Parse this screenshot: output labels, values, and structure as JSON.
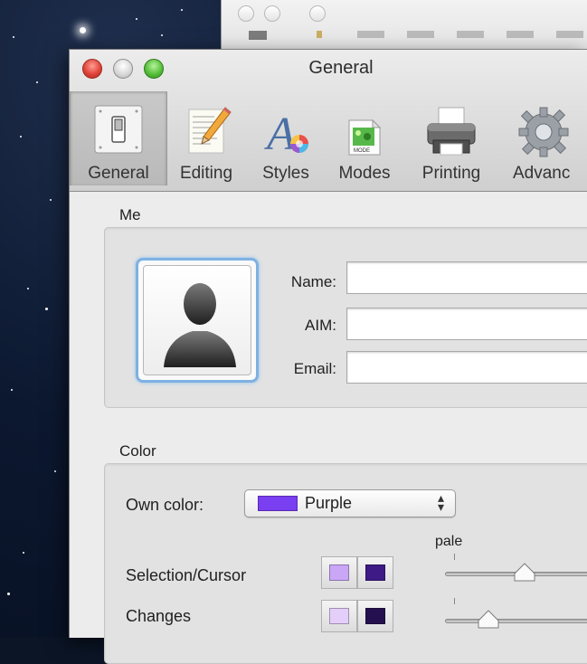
{
  "window": {
    "title": "General"
  },
  "toolbar": {
    "items": [
      {
        "label": "General",
        "icon": "switch-icon",
        "selected": true
      },
      {
        "label": "Editing",
        "icon": "notepad-pencil-icon",
        "selected": false
      },
      {
        "label": "Styles",
        "icon": "styles-letter-icon",
        "selected": false
      },
      {
        "label": "Modes",
        "icon": "mode-icon",
        "selected": false
      },
      {
        "label": "Printing",
        "icon": "printer-icon",
        "selected": false
      },
      {
        "label": "Advanc",
        "icon": "gear-icon",
        "selected": false
      }
    ]
  },
  "me_section": {
    "title": "Me",
    "name_label": "Name:",
    "name_value": "",
    "aim_label": "AIM:",
    "aim_value": "",
    "email_label": "Email:",
    "email_value": ""
  },
  "color_section": {
    "title": "Color",
    "own_color_label": "Own color:",
    "own_color_value": "Purple",
    "own_color_hex": "#7a3ff0",
    "pale_label": "pale",
    "rows": [
      {
        "label": "Selection/Cursor",
        "light_hex": "#c9a6f6",
        "dark_hex": "#3d1a86",
        "level": 0.55
      },
      {
        "label": "Changes",
        "light_hex": "#e3cff9",
        "dark_hex": "#25104f",
        "level": 0.3
      }
    ]
  },
  "colors": {
    "selected_tab_bg": "#c1c1c1",
    "focus_ring": "#7fb1e2"
  }
}
